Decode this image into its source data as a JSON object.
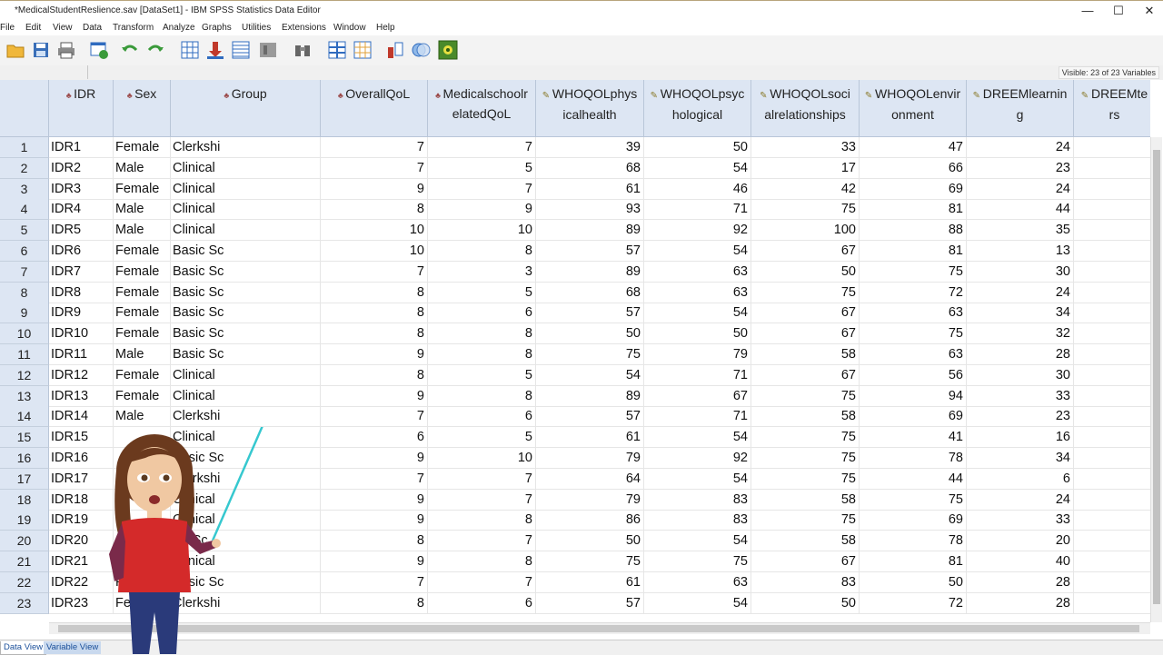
{
  "window": {
    "title": "*MedicalStudentReslience.sav [DataSet1] - IBM SPSS Statistics Data Editor",
    "minimize": "—",
    "maximize": "☐",
    "close": "✕"
  },
  "menu": [
    "File",
    "Edit",
    "View",
    "Data",
    "Transform",
    "Analyze",
    "Graphs",
    "Utilities",
    "Extensions",
    "Window",
    "Help"
  ],
  "toolbar_icons": [
    "open-folder-icon",
    "save-icon",
    "print-icon",
    "dialog-recall-icon",
    "undo-icon",
    "redo-icon",
    "goto-case-icon",
    "goto-variable-icon",
    "variables-icon",
    "run-descriptives-icon",
    "find-icon",
    "split-file-icon",
    "select-cases-icon",
    "value-labels-icon",
    "use-sets-icon",
    "show-all-variables-icon"
  ],
  "status": {
    "visible": "Visible: 23 of 23 Variables"
  },
  "columns": [
    {
      "name": "IDR",
      "label": [
        "IDR"
      ],
      "type": "nominal"
    },
    {
      "name": "Sex",
      "label": [
        "Sex"
      ],
      "type": "nominal"
    },
    {
      "name": "Group",
      "label": [
        "Group"
      ],
      "type": "nominal"
    },
    {
      "name": "OverallQoL",
      "label": [
        "OverallQoL"
      ],
      "type": "nominal"
    },
    {
      "name": "MedicalschoolrelatedQoL",
      "label": [
        "Medicalschoolr",
        "elatedQoL"
      ],
      "type": "nominal"
    },
    {
      "name": "WHOQOLphysicalhealth",
      "label": [
        "WHOQOLphys",
        "icalhealth"
      ],
      "type": "scale"
    },
    {
      "name": "WHOQOLpsychological",
      "label": [
        "WHOQOLpsyc",
        "hological"
      ],
      "type": "scale"
    },
    {
      "name": "WHOQOLsocialrelationships",
      "label": [
        "WHOQOLsoci",
        "alrelationships"
      ],
      "type": "scale"
    },
    {
      "name": "WHOQOLenvironment",
      "label": [
        "WHOQOLenvir",
        "onment"
      ],
      "type": "scale"
    },
    {
      "name": "DREEMlearning",
      "label": [
        "DREEMlearnin",
        "g"
      ],
      "type": "scale"
    },
    {
      "name": "DREEMteachers",
      "label": [
        "DREEMte",
        "rs"
      ],
      "type": "scale"
    }
  ],
  "rows": [
    [
      "IDR1",
      "Female",
      "Clerkshi",
      "7",
      "7",
      "39",
      "50",
      "33",
      "47",
      "24"
    ],
    [
      "IDR2",
      "Male",
      "Clinical",
      "7",
      "5",
      "68",
      "54",
      "17",
      "66",
      "23"
    ],
    [
      "IDR3",
      "Female",
      "Clinical",
      "9",
      "7",
      "61",
      "46",
      "42",
      "69",
      "24"
    ],
    [
      "IDR4",
      "Male",
      "Clinical",
      "8",
      "9",
      "93",
      "71",
      "75",
      "81",
      "44"
    ],
    [
      "IDR5",
      "Male",
      "Clinical",
      "10",
      "10",
      "89",
      "92",
      "100",
      "88",
      "35"
    ],
    [
      "IDR6",
      "Female",
      "Basic Sc",
      "10",
      "8",
      "57",
      "54",
      "67",
      "81",
      "13"
    ],
    [
      "IDR7",
      "Female",
      "Basic Sc",
      "7",
      "3",
      "89",
      "63",
      "50",
      "75",
      "30"
    ],
    [
      "IDR8",
      "Female",
      "Basic Sc",
      "8",
      "5",
      "68",
      "63",
      "75",
      "72",
      "24"
    ],
    [
      "IDR9",
      "Female",
      "Basic Sc",
      "8",
      "6",
      "57",
      "54",
      "67",
      "63",
      "34"
    ],
    [
      "IDR10",
      "Female",
      "Basic Sc",
      "8",
      "8",
      "50",
      "50",
      "67",
      "75",
      "32"
    ],
    [
      "IDR11",
      "Male",
      "Basic Sc",
      "9",
      "8",
      "75",
      "79",
      "58",
      "63",
      "28"
    ],
    [
      "IDR12",
      "Female",
      "Clinical",
      "8",
      "5",
      "54",
      "71",
      "67",
      "56",
      "30"
    ],
    [
      "IDR13",
      "Female",
      "Clinical",
      "9",
      "8",
      "89",
      "67",
      "75",
      "94",
      "33"
    ],
    [
      "IDR14",
      "Male",
      "Clerkshi",
      "7",
      "6",
      "57",
      "71",
      "58",
      "69",
      "23"
    ],
    [
      "IDR15",
      "",
      "Clinical",
      "6",
      "5",
      "61",
      "54",
      "75",
      "41",
      "16"
    ],
    [
      "IDR16",
      "",
      "Basic Sc",
      "9",
      "10",
      "79",
      "92",
      "75",
      "78",
      "34"
    ],
    [
      "IDR17",
      "",
      "Clerkshi",
      "7",
      "7",
      "64",
      "54",
      "75",
      "44",
      "6"
    ],
    [
      "IDR18",
      "",
      "Clinical",
      "9",
      "7",
      "79",
      "83",
      "58",
      "75",
      "24"
    ],
    [
      "IDR19",
      "",
      "Clinical",
      "9",
      "8",
      "86",
      "83",
      "75",
      "69",
      "33"
    ],
    [
      "IDR20",
      "",
      "sic Sc",
      "8",
      "7",
      "50",
      "54",
      "58",
      "78",
      "20"
    ],
    [
      "IDR21",
      "Ma",
      "Clinical",
      "9",
      "8",
      "75",
      "75",
      "67",
      "81",
      "40"
    ],
    [
      "IDR22",
      "F",
      "Basic Sc",
      "7",
      "7",
      "61",
      "63",
      "83",
      "50",
      "28"
    ],
    [
      "IDR23",
      "Fe",
      "Clerkshi",
      "8",
      "6",
      "57",
      "54",
      "50",
      "72",
      "28"
    ]
  ],
  "tabs": {
    "data_view": "Data View",
    "variable_view": "Variable View"
  }
}
